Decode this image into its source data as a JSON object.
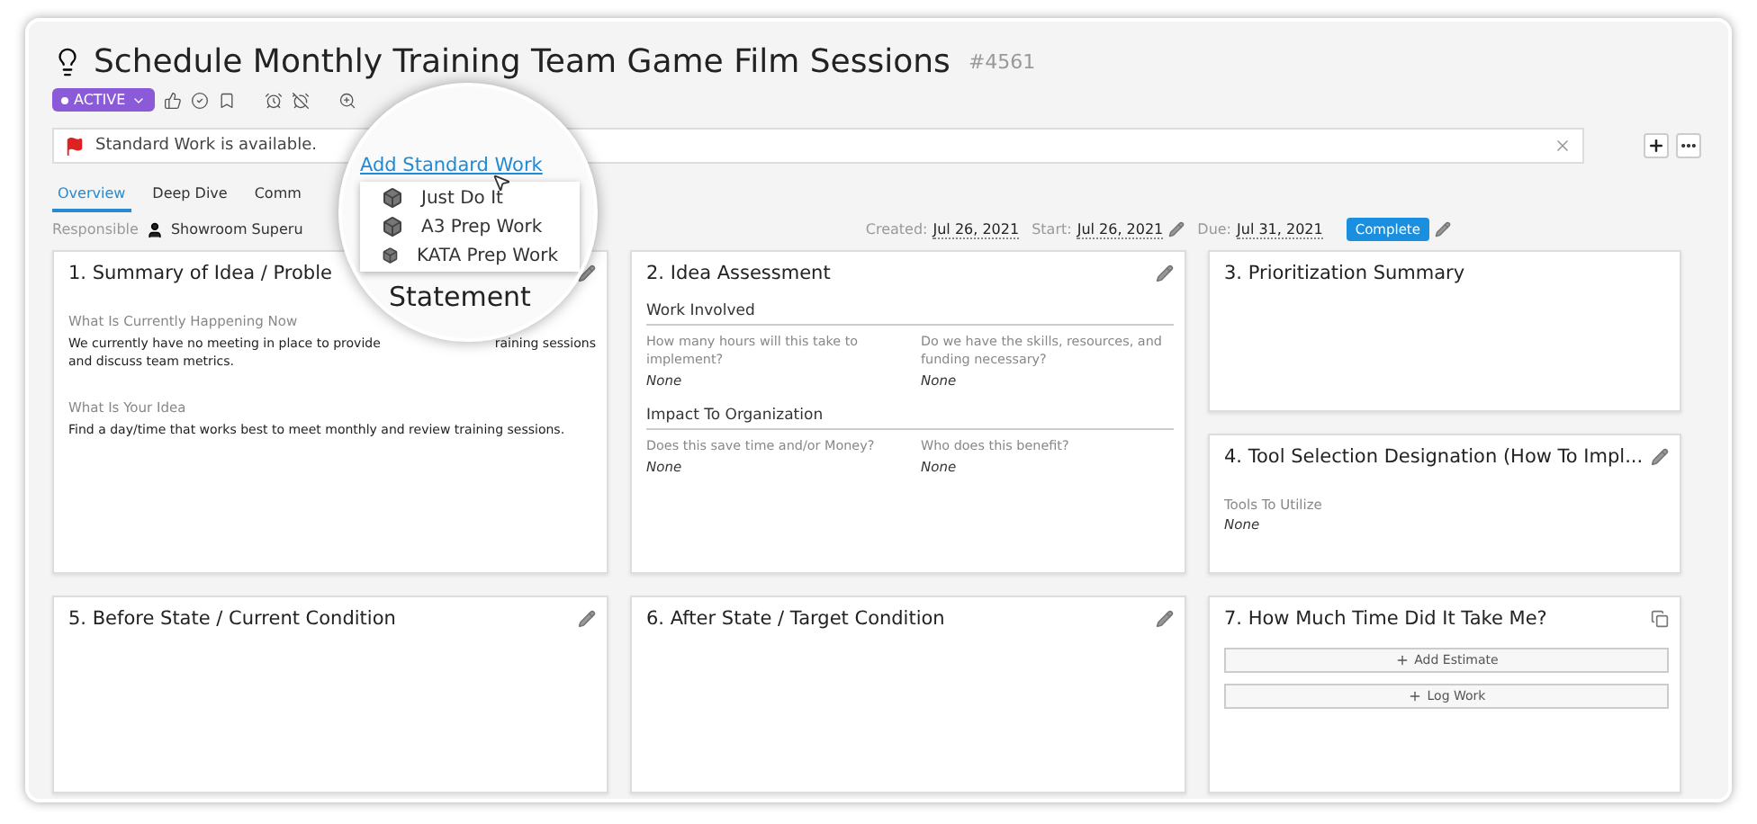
{
  "header": {
    "title": "Schedule Monthly Training Team Game Film Sessions",
    "number": "#4561",
    "status": "ACTIVE"
  },
  "alert": {
    "text": "Standard Work is available."
  },
  "magnifier": {
    "link": "Add Standard Work",
    "menu": [
      "Just Do It",
      "A3 Prep Work",
      "KATA Prep Work"
    ],
    "heading": "Statement"
  },
  "tabs": [
    {
      "label": "Overview",
      "selected": true
    },
    {
      "label": "Deep Dive",
      "selected": false
    },
    {
      "label": "Comm",
      "selected": false
    }
  ],
  "responsible": {
    "label": "Responsible",
    "name": "Showroom Superu"
  },
  "dates": [
    {
      "label": "Created:",
      "value": "Jul 26, 2021",
      "editable": false
    },
    {
      "label": "Start:",
      "value": "Jul 26, 2021",
      "editable": true
    },
    {
      "label": "Due:",
      "value": "Jul 31, 2021",
      "editable": false
    }
  ],
  "complete_button": "Complete",
  "cards": [
    {
      "kind": "summary",
      "title": "1. Summary of Idea / Proble",
      "editable": true,
      "sections": [
        {
          "label": "What Is Currently Happening Now",
          "text_parts": [
            "We currently have no meeting in place to provide",
            "raining sessions",
            "and discuss team metrics."
          ]
        },
        {
          "label": "What Is Your Idea",
          "text_parts": [
            "Find a day/time that works best to meet monthly and review training sessions."
          ]
        }
      ]
    },
    {
      "kind": "assessment",
      "title": "2. Idea Assessment",
      "editable": true,
      "groups": [
        {
          "heading": "Work Involved",
          "fields": [
            {
              "label": "How many hours will this take to implement?",
              "value": "None"
            },
            {
              "label": "Do we have the skills, resources, and funding necessary?",
              "value": "None"
            }
          ]
        },
        {
          "heading": "Impact To Organization",
          "fields": [
            {
              "label": "Does this save time and/or Money?",
              "value": "None"
            },
            {
              "label": "Who does this benefit?",
              "value": "None"
            }
          ]
        }
      ]
    },
    {
      "kind": "plain",
      "title": "3. Prioritization Summary",
      "editable": false
    },
    {
      "kind": "fields",
      "title": "4. Tool Selection Designation (How To Impl...",
      "editable": true,
      "fields": [
        {
          "label": "Tools To Utilize",
          "value": "None"
        }
      ]
    },
    {
      "kind": "plain",
      "title": "5. Before State / Current Condition",
      "editable": true
    },
    {
      "kind": "plain",
      "title": "6. After State / Target Condition",
      "editable": true
    },
    {
      "kind": "buttons",
      "title": "7. How Much Time Did It Take Me?",
      "editable": false,
      "buttons": [
        "Add Estimate",
        "Log Work"
      ]
    }
  ]
}
